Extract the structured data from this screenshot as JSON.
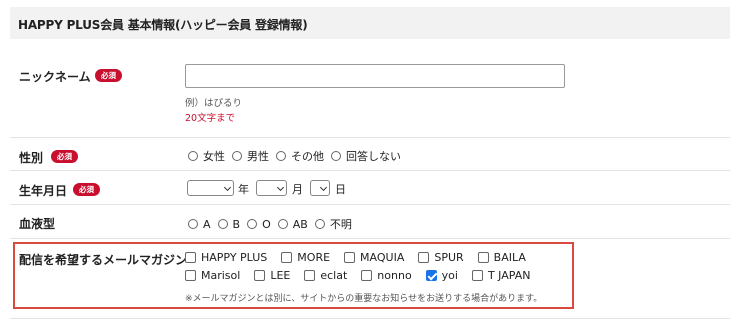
{
  "header": {
    "title": "HAPPY PLUS会員 基本情報(ハッピー会員 登録情報)"
  },
  "required_badge": "必須",
  "nickname": {
    "label": "ニックネーム",
    "value": "",
    "hint": "例）はぴるり",
    "limit": "20文字まで"
  },
  "gender": {
    "label": "性別",
    "options": [
      "女性",
      "男性",
      "その他",
      "回答しない"
    ]
  },
  "birthdate": {
    "label": "生年月日",
    "year_unit": "年",
    "month_unit": "月",
    "day_unit": "日"
  },
  "blood_type": {
    "label": "血液型",
    "options": [
      "A",
      "B",
      "O",
      "AB",
      "不明"
    ]
  },
  "mail_magazine": {
    "label": "配信を希望するメールマガジン",
    "row1": [
      "HAPPY PLUS",
      "MORE",
      "MAQUIA",
      "SPUR",
      "BAILA"
    ],
    "row2": [
      "Marisol",
      "LEE",
      "eclat",
      "nonno",
      "yoi",
      "T JAPAN"
    ],
    "checked": [
      "yoi"
    ],
    "note": "※メールマガジンとは別に、サイトからの重要なお知らせをお送りする場合があります。"
  }
}
